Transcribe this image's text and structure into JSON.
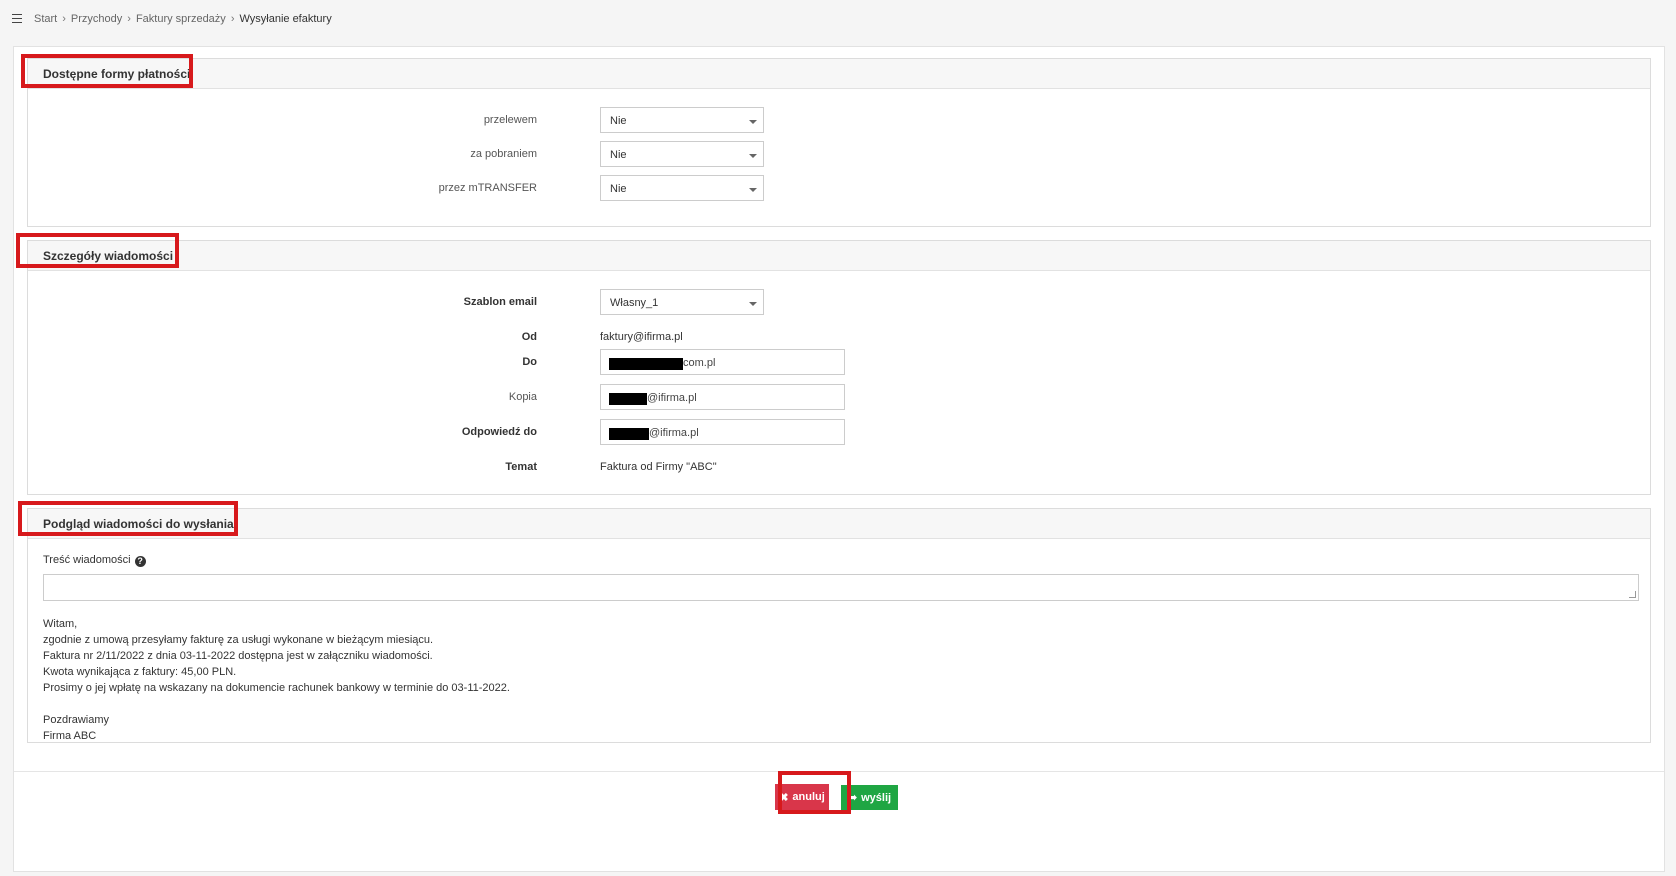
{
  "breadcrumb": {
    "items": [
      "Start",
      "Przychody",
      "Faktury sprzedaży"
    ],
    "current": "Wysyłanie efaktury"
  },
  "payment_section": {
    "title": "Dostępne formy płatności",
    "fields": [
      {
        "label": "przelewem",
        "value": "Nie"
      },
      {
        "label": "za pobraniem",
        "value": "Nie"
      },
      {
        "label": "przez mTRANSFER",
        "value": "Nie"
      }
    ]
  },
  "details_section": {
    "title": "Szczegóły wiadomości",
    "template_label": "Szablon email",
    "template_value": "Własny_1",
    "from_label": "Od",
    "from_value": "faktury@ifirma.pl",
    "to_label": "Do",
    "to_value_visible": "com.pl",
    "cc_label": "Kopia",
    "cc_value_visible": "@ifirma.pl",
    "reply_label": "Odpowiedź do",
    "reply_value_visible": "@ifirma.pl",
    "subject_label": "Temat",
    "subject_value": "Faktura od Firmy \"ABC\""
  },
  "preview_section": {
    "title": "Podgląd wiadomości do wysłania",
    "content_label": "Treść wiadomości",
    "message_lines": [
      "Witam,",
      "zgodnie z umową przesyłamy fakturę za usługi wykonane w bieżącym miesiącu.",
      "Faktura nr 2/11/2022 z dnia 03-11-2022 dostępna jest w załączniku wiadomości.",
      "Kwota wynikająca z faktury: 45,00 PLN.",
      "Prosimy o jej wpłatę na wskazany na dokumencie rachunek bankowy w terminie do 03-11-2022."
    ],
    "signature_lines": [
      "Pozdrawiamy",
      "Firma ABC"
    ]
  },
  "actions": {
    "cancel_label": "anuluj",
    "send_label": "wyślij"
  },
  "colors": {
    "highlight": "#d7191c",
    "cancel": "#d9364a",
    "send": "#1fa643"
  }
}
